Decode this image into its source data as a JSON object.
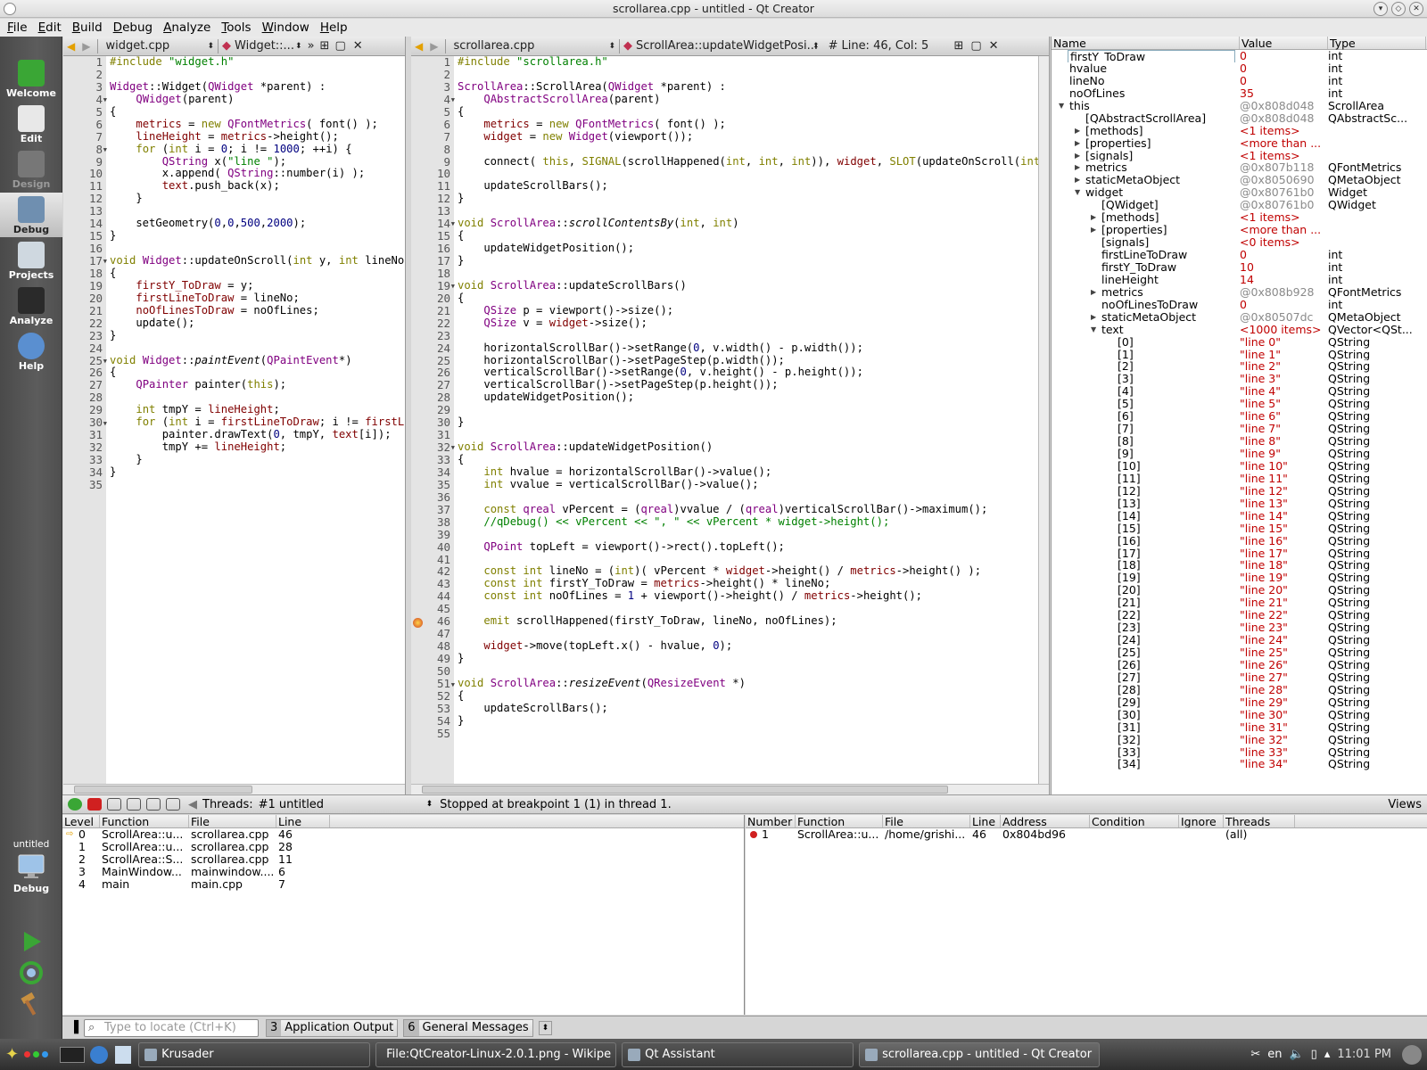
{
  "window": {
    "title": "scrollarea.cpp - untitled - Qt Creator"
  },
  "menu": [
    "File",
    "Edit",
    "Build",
    "Debug",
    "Analyze",
    "Tools",
    "Window",
    "Help"
  ],
  "modes": [
    {
      "label": "Welcome",
      "state": "normal"
    },
    {
      "label": "Edit",
      "state": "normal"
    },
    {
      "label": "Design",
      "state": "disabled"
    },
    {
      "label": "Debug",
      "state": "active"
    },
    {
      "label": "Projects",
      "state": "normal"
    },
    {
      "label": "Analyze",
      "state": "normal"
    },
    {
      "label": "Help",
      "state": "normal"
    }
  ],
  "target": {
    "project": "untitled",
    "mode": "Debug"
  },
  "left_editor": {
    "file": "widget.cpp",
    "symbol": "Widget::...",
    "lines": [
      "<span class='k'>#include</span> <span class='s'>\"widget.h\"</span>",
      "",
      "<span class='t'>Widget</span>::Widget(<span class='t'>QWidget</span> *parent) :",
      "    <span class='t'>QWidget</span>(parent)",
      "{",
      "    <span class='m'>metrics</span> = <span class='k'>new</span> <span class='t'>QFontMetrics</span>( font() );",
      "    <span class='m'>lineHeight</span> = <span class='m'>metrics</span>-&gt;height();",
      "    <span class='k'>for</span> (<span class='k'>int</span> i = <span class='n'>0</span>; i != <span class='n'>1000</span>; ++i) {",
      "        <span class='t'>QString</span> x(<span class='s'>\"line \"</span>);",
      "        x.append( <span class='t'>QString</span>::number(i) );",
      "        <span class='m'>text</span>.push_back(x);",
      "    }",
      "",
      "    setGeometry(<span class='n'>0</span>,<span class='n'>0</span>,<span class='n'>500</span>,<span class='n'>2000</span>);",
      "}",
      "",
      "<span class='k'>void</span> <span class='t'>Widget</span>::updateOnScroll(<span class='k'>int</span> y, <span class='k'>int</span> lineNo, <span class='k'>int</span> noOfLines)",
      "{",
      "    <span class='m'>firstY_ToDraw</span> = y;",
      "    <span class='m'>firstLineToDraw</span> = lineNo;",
      "    <span class='m'>noOfLinesToDraw</span> = noOfLines;",
      "    update();",
      "}",
      "",
      "<span class='k'>void</span> <span class='t'>Widget</span>::<span class='it'>paintEvent</span>(<span class='t'>QPaintEvent</span>*)",
      "{",
      "    <span class='t'>QPainter</span> painter(<span class='k'>this</span>);",
      "",
      "    <span class='k'>int</span> tmpY = <span class='m'>lineHeight</span>;",
      "    <span class='k'>for</span> (<span class='k'>int</span> i = <span class='m'>firstLineToDraw</span>; i != <span class='m'>firstLineToDraw</span> + <span class='m'>noOfLinesToDraw</span>; ++i) {",
      "        painter.drawText(<span class='n'>0</span>, tmpY, <span class='m'>text</span>[i]);",
      "        tmpY += <span class='m'>lineHeight</span>;",
      "    }",
      "}",
      ""
    ]
  },
  "right_editor": {
    "file": "scrollarea.cpp",
    "symbol": "ScrollArea::updateWidgetPosi...",
    "position": "Line: 46, Col: 5",
    "breakpoint_line": 46,
    "lines": [
      "<span class='k'>#include</span> <span class='s'>\"scrollarea.h\"</span>",
      "",
      "<span class='t'>ScrollArea</span>::ScrollArea(<span class='t'>QWidget</span> *parent) :",
      "    <span class='t'>QAbstractScrollArea</span>(parent)",
      "{",
      "    <span class='m'>metrics</span> = <span class='k'>new</span> <span class='t'>QFontMetrics</span>( font() );",
      "    <span class='m'>widget</span> = <span class='k'>new</span> <span class='t'>Widget</span>(viewport());",
      "",
      "    connect( <span class='k'>this</span>, <span class='k'>SIGNAL</span>(scrollHappened(<span class='k'>int</span>, <span class='k'>int</span>, <span class='k'>int</span>)), <span class='m'>widget</span>, <span class='k'>SLOT</span>(updateOnScroll(<span class='k'>int</span>, <span class='k'>int</span>, <span class='k'>int</span>)) );",
      "",
      "    updateScrollBars();",
      "}",
      "",
      "<span class='k'>void</span> <span class='t'>ScrollArea</span>::<span class='it'>scrollContentsBy</span>(<span class='k'>int</span>, <span class='k'>int</span>)",
      "{",
      "    updateWidgetPosition();",
      "}",
      "",
      "<span class='k'>void</span> <span class='t'>ScrollArea</span>::updateScrollBars()",
      "{",
      "    <span class='t'>QSize</span> p = viewport()-&gt;size();",
      "    <span class='t'>QSize</span> v = <span class='m'>widget</span>-&gt;size();",
      "",
      "    horizontalScrollBar()-&gt;setRange(<span class='n'>0</span>, v.width() - p.width());",
      "    horizontalScrollBar()-&gt;setPageStep(p.width());",
      "    verticalScrollBar()-&gt;setRange(<span class='n'>0</span>, v.height() - p.height());",
      "    verticalScrollBar()-&gt;setPageStep(p.height());",
      "    updateWidgetPosition();",
      "",
      "}",
      "",
      "<span class='k'>void</span> <span class='t'>ScrollArea</span>::updateWidgetPosition()",
      "{",
      "    <span class='k'>int</span> hvalue = horizontalScrollBar()-&gt;value();",
      "    <span class='k'>int</span> vvalue = verticalScrollBar()-&gt;value();",
      "",
      "    <span class='k'>const</span> <span class='t'>qreal</span> vPercent = (<span class='t'>qreal</span>)vvalue / (<span class='t'>qreal</span>)verticalScrollBar()-&gt;maximum();",
      "    <span class='cm'>//qDebug() &lt;&lt; vPercent &lt;&lt; \", \" &lt;&lt; vPercent * widget-&gt;height();</span>",
      "",
      "    <span class='t'>QPoint</span> topLeft = viewport()-&gt;rect().topLeft();",
      "",
      "    <span class='k'>const</span> <span class='k'>int</span> lineNo = (<span class='k'>int</span>)( vPercent * <span class='m'>widget</span>-&gt;height() / <span class='m'>metrics</span>-&gt;height() );",
      "    <span class='k'>const</span> <span class='k'>int</span> firstY_ToDraw = <span class='m'>metrics</span>-&gt;height() * lineNo;",
      "    <span class='k'>const</span> <span class='k'>int</span> noOfLines = <span class='n'>1</span> + viewport()-&gt;height() / <span class='m'>metrics</span>-&gt;height();",
      "",
      "    <span class='k'>emit</span> scrollHappened(firstY_ToDraw, lineNo, noOfLines);",
      "",
      "    <span class='m'>widget</span>-&gt;move(topLeft.x() - hvalue, <span class='n'>0</span>);",
      "}",
      "",
      "<span class='k'>void</span> <span class='t'>ScrollArea</span>::<span class='it'>resizeEvent</span>(<span class='t'>QResizeEvent</span> *)",
      "{",
      "    updateScrollBars();",
      "}",
      ""
    ]
  },
  "watch": {
    "headers": [
      "Name",
      "Value",
      "Type"
    ],
    "rows": [
      {
        "name": "firstY_ToDraw",
        "value": "0",
        "type": "int",
        "depth": 0,
        "tw": ""
      },
      {
        "name": "hvalue",
        "value": "0",
        "type": "int",
        "depth": 0,
        "tw": ""
      },
      {
        "name": "lineNo",
        "value": "0",
        "type": "int",
        "depth": 0,
        "tw": ""
      },
      {
        "name": "noOfLines",
        "value": "35",
        "type": "int",
        "depth": 0,
        "tw": ""
      },
      {
        "name": "this",
        "value": "@0x808d048",
        "type": "ScrollArea",
        "depth": 0,
        "tw": "open"
      },
      {
        "name": "[QAbstractScrollArea]",
        "value": "@0x808d048",
        "type": "QAbstractSc...",
        "depth": 1,
        "tw": ""
      },
      {
        "name": "[methods]",
        "value": "<1 items>",
        "type": "",
        "depth": 1,
        "tw": "closed"
      },
      {
        "name": "[properties]",
        "value": "<more than ...",
        "type": "",
        "depth": 1,
        "tw": "closed"
      },
      {
        "name": "[signals]",
        "value": "<1 items>",
        "type": "",
        "depth": 1,
        "tw": "closed"
      },
      {
        "name": "metrics",
        "value": "@0x807b118",
        "type": "QFontMetrics",
        "depth": 1,
        "tw": "closed"
      },
      {
        "name": "staticMetaObject",
        "value": "@0x8050690",
        "type": "QMetaObject",
        "depth": 1,
        "tw": "closed"
      },
      {
        "name": "widget",
        "value": "@0x80761b0",
        "type": "Widget",
        "depth": 1,
        "tw": "open"
      },
      {
        "name": "[QWidget]",
        "value": "@0x80761b0",
        "type": "QWidget",
        "depth": 2,
        "tw": ""
      },
      {
        "name": "[methods]",
        "value": "<1 items>",
        "type": "",
        "depth": 2,
        "tw": "closed"
      },
      {
        "name": "[properties]",
        "value": "<more than ...",
        "type": "",
        "depth": 2,
        "tw": "closed"
      },
      {
        "name": "[signals]",
        "value": "<0 items>",
        "type": "",
        "depth": 2,
        "tw": ""
      },
      {
        "name": "firstLineToDraw",
        "value": "0",
        "type": "int",
        "depth": 2,
        "tw": ""
      },
      {
        "name": "firstY_ToDraw",
        "value": "10",
        "type": "int",
        "depth": 2,
        "tw": ""
      },
      {
        "name": "lineHeight",
        "value": "14",
        "type": "int",
        "depth": 2,
        "tw": ""
      },
      {
        "name": "metrics",
        "value": "@0x808b928",
        "type": "QFontMetrics",
        "depth": 2,
        "tw": "closed"
      },
      {
        "name": "noOfLinesToDraw",
        "value": "0",
        "type": "int",
        "depth": 2,
        "tw": ""
      },
      {
        "name": "staticMetaObject",
        "value": "@0x80507dc",
        "type": "QMetaObject",
        "depth": 2,
        "tw": "closed"
      },
      {
        "name": "text",
        "value": "<1000 items>",
        "type": "QVector<QSt...",
        "depth": 2,
        "tw": "open"
      },
      {
        "name": "[0]",
        "value": "\"line 0\"",
        "type": "QString",
        "depth": 3,
        "tw": ""
      },
      {
        "name": "[1]",
        "value": "\"line 1\"",
        "type": "QString",
        "depth": 3,
        "tw": ""
      },
      {
        "name": "[2]",
        "value": "\"line 2\"",
        "type": "QString",
        "depth": 3,
        "tw": ""
      },
      {
        "name": "[3]",
        "value": "\"line 3\"",
        "type": "QString",
        "depth": 3,
        "tw": ""
      },
      {
        "name": "[4]",
        "value": "\"line 4\"",
        "type": "QString",
        "depth": 3,
        "tw": ""
      },
      {
        "name": "[5]",
        "value": "\"line 5\"",
        "type": "QString",
        "depth": 3,
        "tw": ""
      },
      {
        "name": "[6]",
        "value": "\"line 6\"",
        "type": "QString",
        "depth": 3,
        "tw": ""
      },
      {
        "name": "[7]",
        "value": "\"line 7\"",
        "type": "QString",
        "depth": 3,
        "tw": ""
      },
      {
        "name": "[8]",
        "value": "\"line 8\"",
        "type": "QString",
        "depth": 3,
        "tw": ""
      },
      {
        "name": "[9]",
        "value": "\"line 9\"",
        "type": "QString",
        "depth": 3,
        "tw": ""
      },
      {
        "name": "[10]",
        "value": "\"line 10\"",
        "type": "QString",
        "depth": 3,
        "tw": ""
      },
      {
        "name": "[11]",
        "value": "\"line 11\"",
        "type": "QString",
        "depth": 3,
        "tw": ""
      },
      {
        "name": "[12]",
        "value": "\"line 12\"",
        "type": "QString",
        "depth": 3,
        "tw": ""
      },
      {
        "name": "[13]",
        "value": "\"line 13\"",
        "type": "QString",
        "depth": 3,
        "tw": ""
      },
      {
        "name": "[14]",
        "value": "\"line 14\"",
        "type": "QString",
        "depth": 3,
        "tw": ""
      },
      {
        "name": "[15]",
        "value": "\"line 15\"",
        "type": "QString",
        "depth": 3,
        "tw": ""
      },
      {
        "name": "[16]",
        "value": "\"line 16\"",
        "type": "QString",
        "depth": 3,
        "tw": ""
      },
      {
        "name": "[17]",
        "value": "\"line 17\"",
        "type": "QString",
        "depth": 3,
        "tw": ""
      },
      {
        "name": "[18]",
        "value": "\"line 18\"",
        "type": "QString",
        "depth": 3,
        "tw": ""
      },
      {
        "name": "[19]",
        "value": "\"line 19\"",
        "type": "QString",
        "depth": 3,
        "tw": ""
      },
      {
        "name": "[20]",
        "value": "\"line 20\"",
        "type": "QString",
        "depth": 3,
        "tw": ""
      },
      {
        "name": "[21]",
        "value": "\"line 21\"",
        "type": "QString",
        "depth": 3,
        "tw": ""
      },
      {
        "name": "[22]",
        "value": "\"line 22\"",
        "type": "QString",
        "depth": 3,
        "tw": ""
      },
      {
        "name": "[23]",
        "value": "\"line 23\"",
        "type": "QString",
        "depth": 3,
        "tw": ""
      },
      {
        "name": "[24]",
        "value": "\"line 24\"",
        "type": "QString",
        "depth": 3,
        "tw": ""
      },
      {
        "name": "[25]",
        "value": "\"line 25\"",
        "type": "QString",
        "depth": 3,
        "tw": ""
      },
      {
        "name": "[26]",
        "value": "\"line 26\"",
        "type": "QString",
        "depth": 3,
        "tw": ""
      },
      {
        "name": "[27]",
        "value": "\"line 27\"",
        "type": "QString",
        "depth": 3,
        "tw": ""
      },
      {
        "name": "[28]",
        "value": "\"line 28\"",
        "type": "QString",
        "depth": 3,
        "tw": ""
      },
      {
        "name": "[29]",
        "value": "\"line 29\"",
        "type": "QString",
        "depth": 3,
        "tw": ""
      },
      {
        "name": "[30]",
        "value": "\"line 30\"",
        "type": "QString",
        "depth": 3,
        "tw": ""
      },
      {
        "name": "[31]",
        "value": "\"line 31\"",
        "type": "QString",
        "depth": 3,
        "tw": ""
      },
      {
        "name": "[32]",
        "value": "\"line 32\"",
        "type": "QString",
        "depth": 3,
        "tw": ""
      },
      {
        "name": "[33]",
        "value": "\"line 33\"",
        "type": "QString",
        "depth": 3,
        "tw": ""
      },
      {
        "name": "[34]",
        "value": "\"line 34\"",
        "type": "QString",
        "depth": 3,
        "tw": ""
      }
    ]
  },
  "debugbar": {
    "threads_label": "Threads:",
    "thread": "#1 untitled",
    "status": "Stopped at breakpoint 1 (1) in thread 1.",
    "views": "Views"
  },
  "stack": {
    "headers": [
      "Level",
      "Function",
      "File",
      "Line"
    ],
    "rows": [
      [
        "0",
        "ScrollArea::u...",
        "scrollarea.cpp",
        "46"
      ],
      [
        "1",
        "ScrollArea::u...",
        "scrollarea.cpp",
        "28"
      ],
      [
        "2",
        "ScrollArea::S...",
        "scrollarea.cpp",
        "11"
      ],
      [
        "3",
        "MainWindow...",
        "mainwindow....",
        "6"
      ],
      [
        "4",
        "main",
        "main.cpp",
        "7"
      ]
    ]
  },
  "breakpoints": {
    "headers": [
      "Number",
      "Function",
      "File",
      "Line",
      "Address",
      "Condition",
      "Ignore",
      "Threads"
    ],
    "rows": [
      [
        "1",
        "ScrollArea::u...",
        "/home/grishi...",
        "46",
        "0x804bd96",
        "",
        "",
        "(all)"
      ]
    ]
  },
  "output": {
    "locator_placeholder": "Type to locate (Ctrl+K)",
    "tabs": [
      {
        "num": "3",
        "label": "Application Output"
      },
      {
        "num": "6",
        "label": "General Messages"
      }
    ]
  },
  "taskbar": {
    "tasks": [
      "Krusader",
      "File:QtCreator-Linux-2.0.1.png - Wikipe",
      "Qt Assistant",
      "scrollarea.cpp - untitled - Qt Creator"
    ],
    "lang": "en",
    "clock": "11:01 PM"
  },
  "colors": {
    "accent_green": "#3aa635",
    "keyword": "#808000",
    "type": "#800080",
    "string": "#008000",
    "number": "#000080",
    "member": "#800000",
    "watch_value": "#c00000"
  }
}
